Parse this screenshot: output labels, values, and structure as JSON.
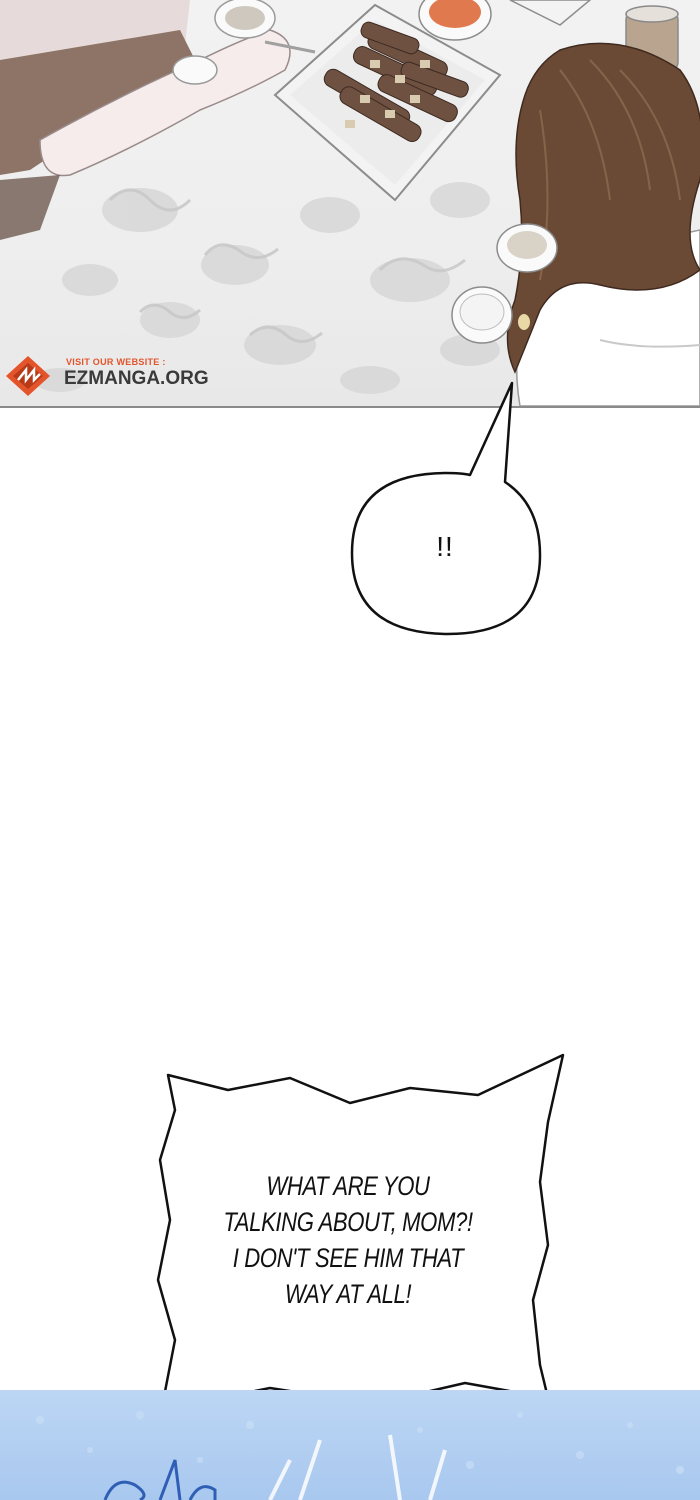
{
  "watermark": {
    "small_text": "VISIT OUR WEBSITE :",
    "site_text": "EZMANGA.ORG",
    "badge_icon": "ezmanga-logo-icon",
    "accent_color": "#e3542b"
  },
  "bubbles": {
    "exclamation": "!!",
    "dialogue_lines": [
      "WHAT ARE YOU",
      "TALKING ABOUT, MOM?!",
      "I DON'T SEE HIM THAT",
      "WAY AT ALL!"
    ]
  },
  "colors": {
    "tablecloth": "#eeeeee",
    "hair": "#6b4a35",
    "bottom_panel": "#b2cff2"
  }
}
